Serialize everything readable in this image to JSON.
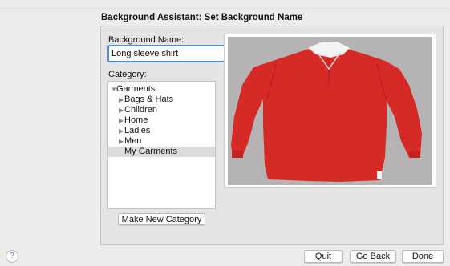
{
  "dialog": {
    "title": "Background Assistant: Set Background Name"
  },
  "name": {
    "label": "Background Name:",
    "value": "Long sleeve shirt"
  },
  "category": {
    "label": "Category:",
    "tree": [
      {
        "label": "Garments",
        "expanded": true
      },
      {
        "label": "Bags & Hats",
        "expanded": false
      },
      {
        "label": "Children",
        "expanded": false
      },
      {
        "label": "Home",
        "expanded": false
      },
      {
        "label": "Ladies",
        "expanded": false
      },
      {
        "label": "Men",
        "expanded": false
      },
      {
        "label": "My Garments",
        "selected": true
      }
    ],
    "new_category_button": "Make New Category"
  },
  "preview": {
    "shirt_color": "#d62a27",
    "collar_color": "#f4f4f4",
    "background_color": "#b5b3b4"
  },
  "footer": {
    "help": "?",
    "quit": "Quit",
    "go_back": "Go Back",
    "done": "Done"
  }
}
